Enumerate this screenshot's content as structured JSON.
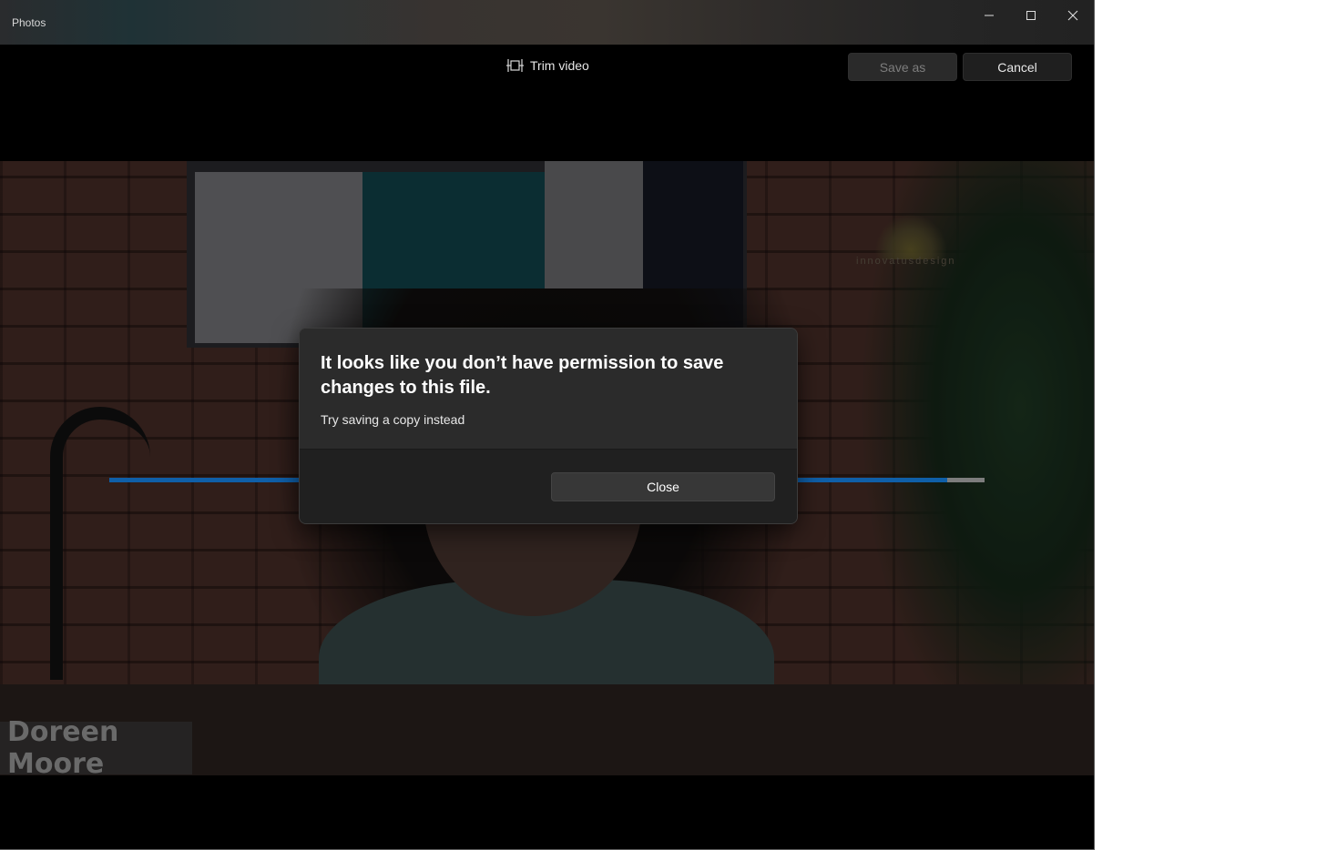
{
  "window": {
    "title": "Photos",
    "controls": {
      "minimize_icon": "minimize-icon",
      "maximize_icon": "maximize-icon",
      "close_icon": "close-icon"
    }
  },
  "toolbar": {
    "mode_icon": "trim-icon",
    "mode_label": "Trim video",
    "save_as_label": "Save as",
    "cancel_label": "Cancel"
  },
  "video": {
    "name_overlay": "Doreen Moore",
    "watermark": "innovatusdesign",
    "trim": {
      "accent_color": "#0f5fa8"
    }
  },
  "dialog": {
    "title": "It looks like you don’t have permission to save changes to this file.",
    "message": "Try saving a copy instead",
    "close_label": "Close"
  }
}
